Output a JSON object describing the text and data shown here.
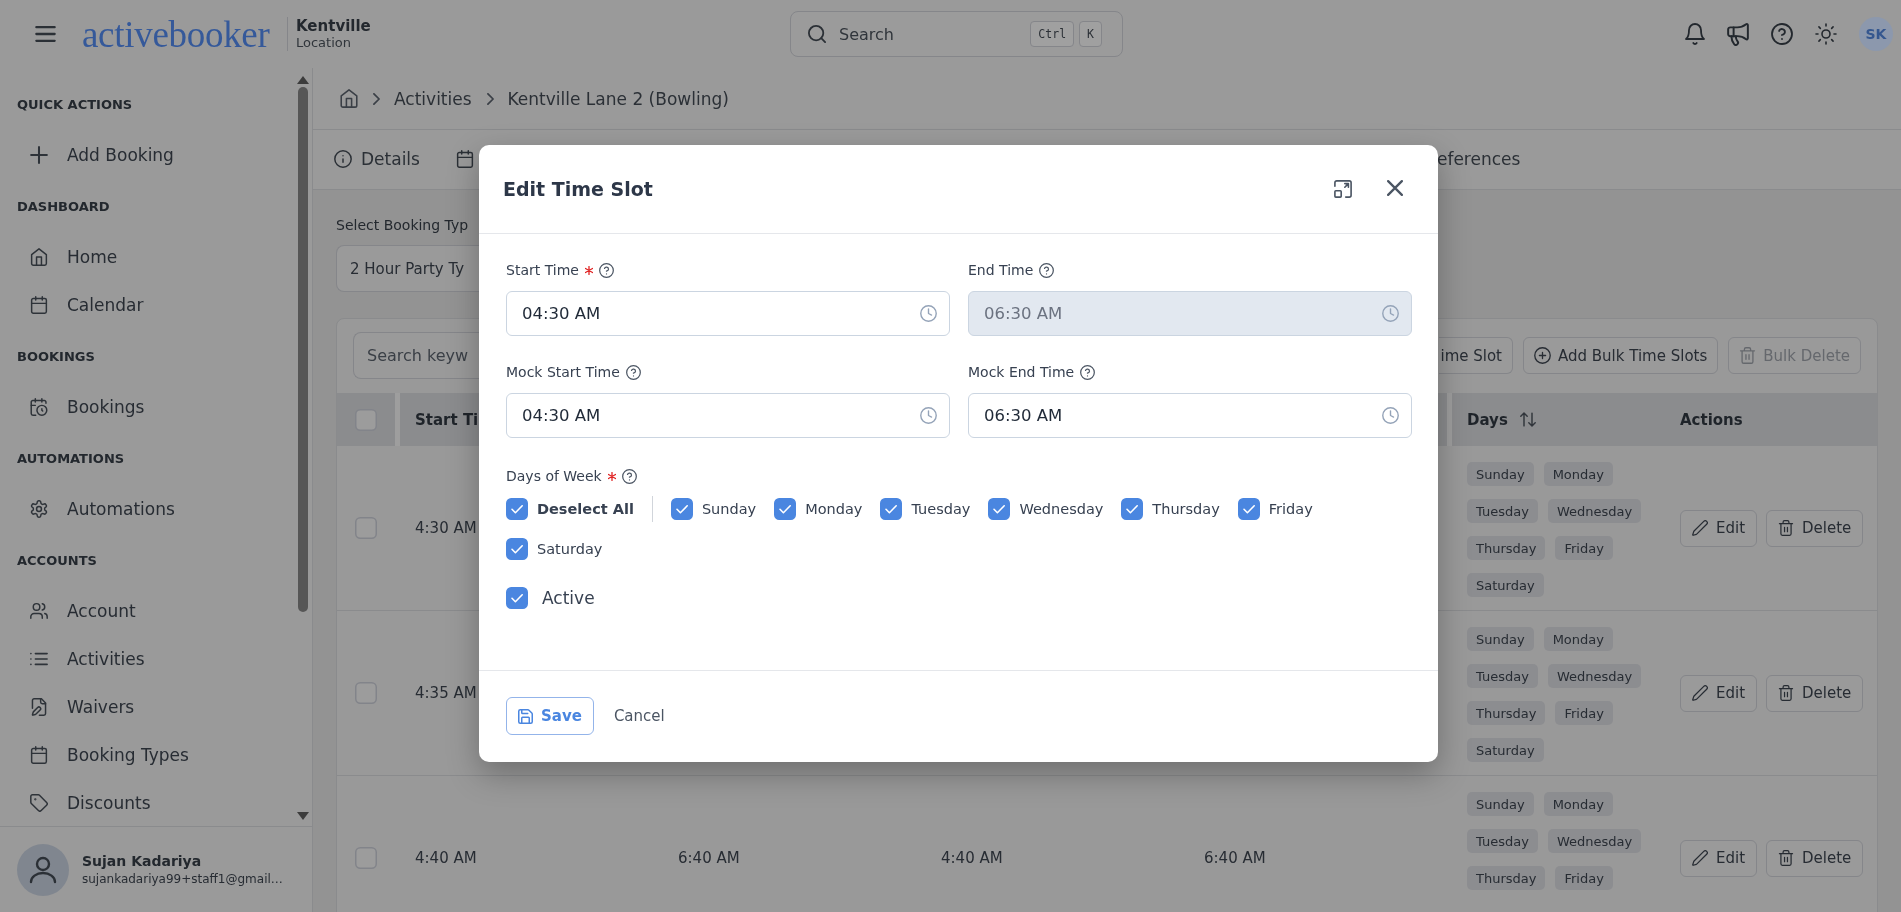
{
  "topbar": {
    "logo": "activebooker",
    "location": {
      "name": "Kentville",
      "label": "Location"
    },
    "search": {
      "placeholder": "Search",
      "shortcut": [
        "Ctrl",
        "K"
      ]
    },
    "avatar": "SK"
  },
  "sidebar": {
    "sections": [
      {
        "title": "QUICK ACTIONS",
        "items": [
          {
            "label": "Add Booking",
            "selected": false
          }
        ]
      },
      {
        "title": "DASHBOARD",
        "items": [
          {
            "label": "Home",
            "selected": false
          },
          {
            "label": "Calendar",
            "selected": false
          }
        ]
      },
      {
        "title": "BOOKINGS",
        "items": [
          {
            "label": "Bookings",
            "selected": false
          }
        ]
      },
      {
        "title": "AUTOMATIONS",
        "items": [
          {
            "label": "Automations",
            "selected": false
          }
        ]
      },
      {
        "title": "ACCOUNTS",
        "items": [
          {
            "label": "Account",
            "selected": false
          },
          {
            "label": "Activities",
            "selected": false
          },
          {
            "label": "Waivers",
            "selected": false
          },
          {
            "label": "Booking Types",
            "selected": false
          },
          {
            "label": "Discounts",
            "selected": false
          }
        ]
      }
    ],
    "user": {
      "name": "Sujan Kadariya",
      "email": "sujankadariya99+staff1@gmail…"
    }
  },
  "breadcrumb": {
    "items": [
      "Activities",
      "Kentville Lane 2 (Bowling)"
    ]
  },
  "tabs": [
    {
      "label": "Details",
      "selected": false
    },
    {
      "selected": false
    },
    {
      "label": "eferences",
      "selected": false
    }
  ],
  "booking_type": {
    "label": "Select Booking Typ",
    "value": "2 Hour Party Ty"
  },
  "table": {
    "search": {
      "placeholder": "Search keyw"
    },
    "toolbar": [
      {
        "label": "ime Slot",
        "disabled": false
      },
      {
        "label": "Add Bulk Time Slots",
        "disabled": false
      },
      {
        "label": "Bulk Delete",
        "disabled": true
      }
    ],
    "header_checkbox": {
      "checked": false
    },
    "columns": [
      {
        "label": "Start Ti",
        "sortable": false
      },
      {
        "label": "Days",
        "sortable": true
      },
      {
        "label": "Actions",
        "sortable": false
      }
    ],
    "rows": [
      {
        "checked": false,
        "times": [
          "4:30 AM"
        ],
        "days": [
          "Sunday",
          "Monday",
          "Tuesday",
          "Wednesday",
          "Thursday",
          "Friday",
          "Saturday"
        ],
        "actions": [
          "Edit",
          "Delete"
        ]
      },
      {
        "checked": false,
        "times": [
          "4:35 AM"
        ],
        "days": [
          "Sunday",
          "Monday",
          "Tuesday",
          "Wednesday",
          "Thursday",
          "Friday",
          "Saturday"
        ],
        "actions": [
          "Edit",
          "Delete"
        ]
      },
      {
        "checked": false,
        "times": [
          "4:40 AM",
          "6:40 AM",
          "4:40 AM",
          "6:40 AM"
        ],
        "days": [
          "Sunday",
          "Monday",
          "Tuesday",
          "Wednesday",
          "Thursday",
          "Friday"
        ],
        "actions": [
          "Edit",
          "Delete"
        ]
      }
    ]
  },
  "modal": {
    "title": "Edit Time Slot",
    "fields": [
      {
        "label": "Start Time",
        "required": true,
        "value": "04:30 AM",
        "disabled": false
      },
      {
        "label": "End Time",
        "required": false,
        "value": "06:30 AM",
        "disabled": true
      },
      {
        "label": "Mock Start Time",
        "required": false,
        "value": "04:30 AM",
        "disabled": false
      },
      {
        "label": "Mock End Time",
        "required": false,
        "value": "06:30 AM",
        "disabled": false
      }
    ],
    "days_of_week": {
      "label": "Days of Week",
      "required": true,
      "toggle_all": {
        "label": "Deselect All",
        "checked": true
      },
      "days": [
        {
          "label": "Sunday",
          "checked": true
        },
        {
          "label": "Monday",
          "checked": true
        },
        {
          "label": "Tuesday",
          "checked": true
        },
        {
          "label": "Wednesday",
          "checked": true
        },
        {
          "label": "Thursday",
          "checked": true
        },
        {
          "label": "Friday",
          "checked": true
        },
        {
          "label": "Saturday",
          "checked": true
        }
      ]
    },
    "active": {
      "label": "Active",
      "checked": true
    },
    "buttons": {
      "save": "Save",
      "cancel": "Cancel"
    }
  }
}
